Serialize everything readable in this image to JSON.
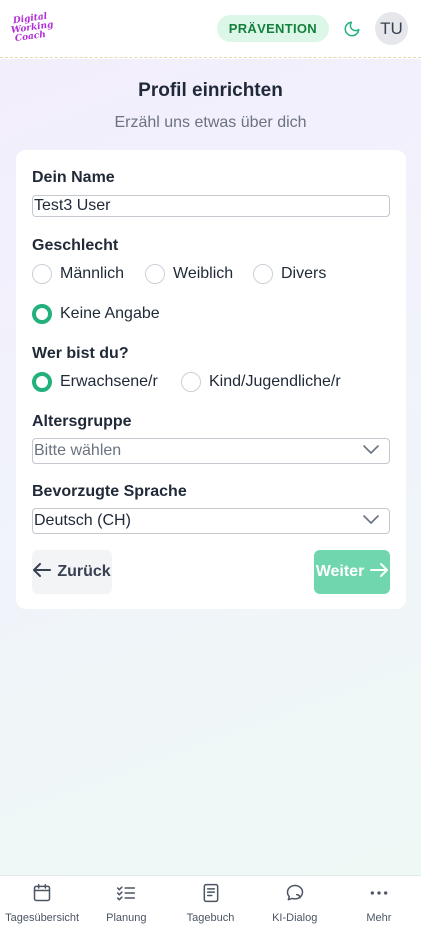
{
  "header": {
    "logo_lines": [
      "Digital",
      "Working",
      "Coach"
    ],
    "badge": "PRÄVENTION",
    "avatar_initials": "TU"
  },
  "page": {
    "title": "Profil einrichten",
    "subtitle": "Erzähl uns etwas über dich"
  },
  "form": {
    "name_label": "Dein Name",
    "name_value": "Test3 User",
    "gender_label": "Geschlecht",
    "gender_options": [
      "Männlich",
      "Weiblich",
      "Divers",
      "Keine Angabe"
    ],
    "gender_selected": "Keine Angabe",
    "who_label": "Wer bist du?",
    "who_options": [
      "Erwachsene/r",
      "Kind/Jugendliche/r"
    ],
    "who_selected": "Erwachsene/r",
    "age_label": "Altersgruppe",
    "age_placeholder": "Bitte wählen",
    "language_label": "Bevorzugte Sprache",
    "language_value": "Deutsch (CH)",
    "back_label": "Zurück",
    "next_label": "Weiter"
  },
  "bottom_nav": [
    {
      "label": "Tagesübersicht",
      "icon": "calendar-icon"
    },
    {
      "label": "Planung",
      "icon": "checklist-icon"
    },
    {
      "label": "Tagebuch",
      "icon": "book-icon"
    },
    {
      "label": "KI-Dialog",
      "icon": "chat-icon"
    },
    {
      "label": "Mehr",
      "icon": "more-icon"
    }
  ],
  "colors": {
    "accent": "#22b07d",
    "badge_bg": "#dcf7e7",
    "next_button": "#6fd6ad",
    "logo": "#b12fd8"
  }
}
